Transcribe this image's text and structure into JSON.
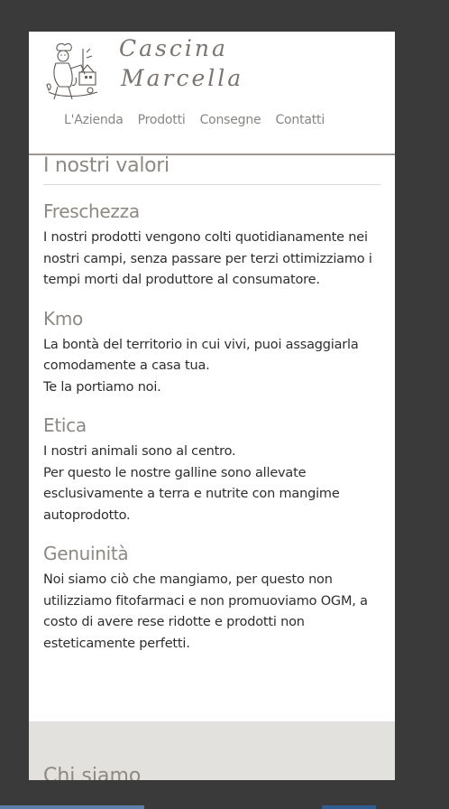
{
  "brand": {
    "line1": "Cascina",
    "line2": "Marcella"
  },
  "nav": {
    "items": [
      "L'Azienda",
      "Prodotti",
      "Consegne",
      "Contatti"
    ]
  },
  "section": {
    "title": "I nostri valori"
  },
  "values": [
    {
      "heading": "Freschezza",
      "lines": [
        "I nostri prodotti vengono colti quotidianamente nei nostri campi, senza passare per terzi ottimizziamo i tempi morti dal produttore al consumatore."
      ]
    },
    {
      "heading": "Kmo",
      "lines": [
        "La bontà del territorio in cui vivi, puoi assaggiarla comodamente a casa tua.",
        "Te la portiamo noi."
      ]
    },
    {
      "heading": "Etica",
      "lines": [
        "I nostri animali sono al centro.",
        "Per questo le nostre galline sono allevate esclusivamente a terra e nutrite con mangime autoprodotto."
      ]
    },
    {
      "heading": "Genuinità",
      "lines": [
        "Noi siamo ciò che mangiamo, per questo non utilizziamo fitofarmaci e non promuoviamo OGM, a costo di avere rese ridotte e prodotti non esteticamente perfetti."
      ]
    }
  ],
  "next_section": {
    "title": "Chi siamo"
  },
  "colors": {
    "background": "#3a3a3a",
    "heading": "#8e8882",
    "band": "#e3e1dd"
  },
  "icons": {
    "logo": "farmer-illustration-logo"
  }
}
